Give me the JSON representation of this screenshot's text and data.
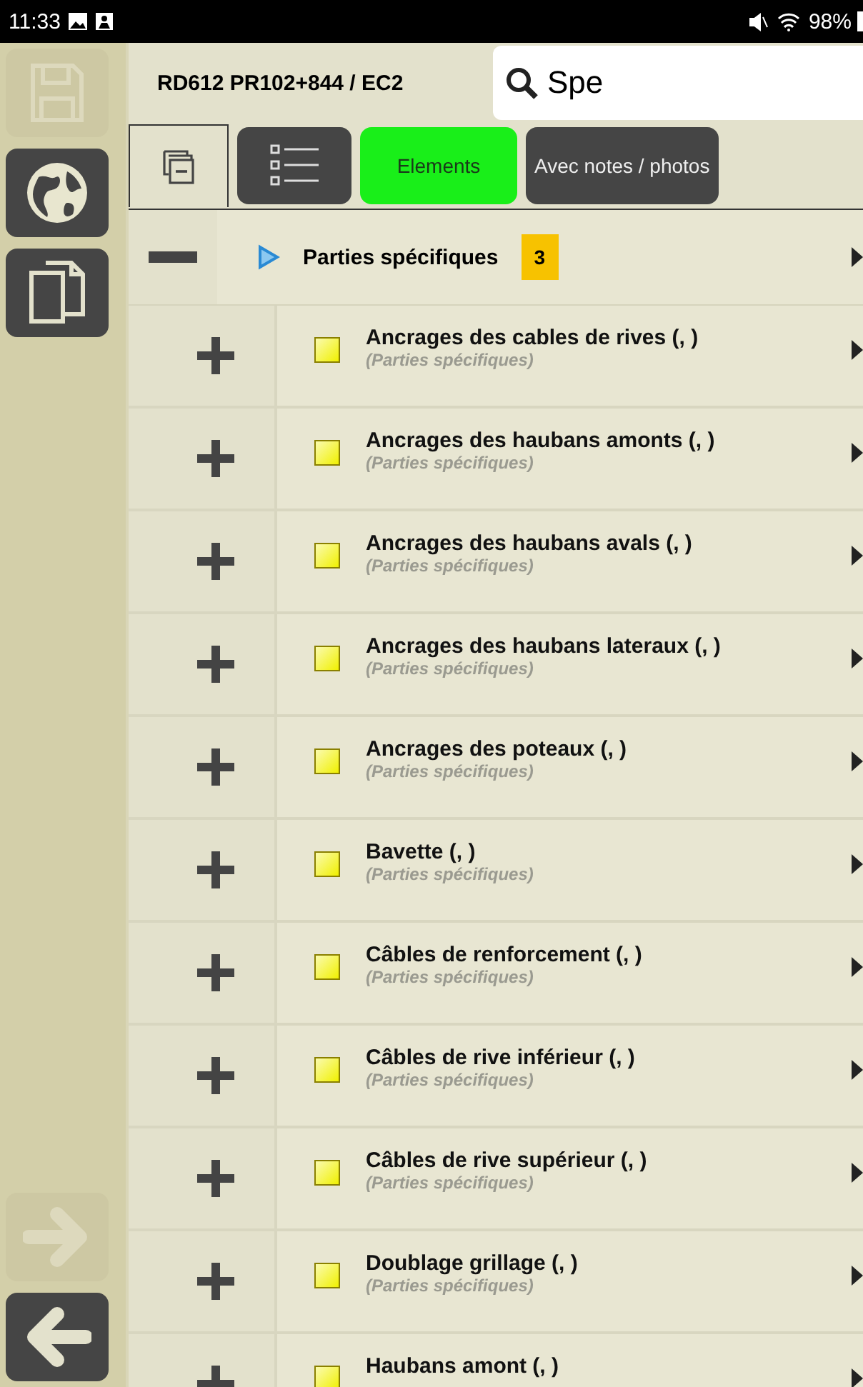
{
  "status_bar": {
    "time": "11:33",
    "battery": "98%"
  },
  "sidebar": {
    "buttons": [
      {
        "kind": "save",
        "disabled": true
      },
      {
        "kind": "globe",
        "disabled": false
      },
      {
        "kind": "copy",
        "disabled": false
      }
    ],
    "bottom_buttons": [
      {
        "kind": "forward",
        "disabled": true
      },
      {
        "kind": "back",
        "disabled": false
      }
    ]
  },
  "header": {
    "title": "RD612 PR102+844 / EC2",
    "search": {
      "value": "Spe"
    }
  },
  "tabs": [
    {
      "label": "Elements",
      "selected": true
    },
    {
      "label": "Avec notes / photos",
      "selected": false
    }
  ],
  "group": {
    "label": "Parties spécifiques",
    "count": "3",
    "expanded": true
  },
  "items": [
    {
      "title": "Ancrages des cables de rives (, )",
      "subtitle": "(Parties spécifiques)",
      "checked": false
    },
    {
      "title": "Ancrages des haubans amonts (, )",
      "subtitle": "(Parties spécifiques)",
      "checked": false
    },
    {
      "title": "Ancrages des haubans avals (, )",
      "subtitle": "(Parties spécifiques)",
      "checked": false
    },
    {
      "title": "Ancrages des haubans lateraux (, )",
      "subtitle": "(Parties spécifiques)",
      "checked": false
    },
    {
      "title": "Ancrages des poteaux (, )",
      "subtitle": "(Parties spécifiques)",
      "checked": false
    },
    {
      "title": "Bavette (, )",
      "subtitle": "(Parties spécifiques)",
      "checked": false
    },
    {
      "title": "Câbles de renforcement (, )",
      "subtitle": "(Parties spécifiques)",
      "checked": false
    },
    {
      "title": "Câbles de rive inférieur (, )",
      "subtitle": "(Parties spécifiques)",
      "checked": false
    },
    {
      "title": "Câbles de rive supérieur (, )",
      "subtitle": "(Parties spécifiques)",
      "checked": false
    },
    {
      "title": "Doublage grillage (, )",
      "subtitle": "(Parties spécifiques)",
      "checked": false
    },
    {
      "title": "Haubans amont (, )",
      "checked": false
    }
  ]
}
